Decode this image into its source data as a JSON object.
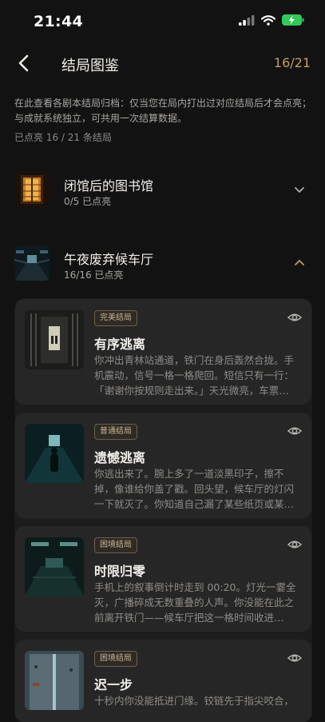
{
  "status_bar": {
    "time": "21:44"
  },
  "header": {
    "title": "结局图鉴",
    "count": "16/21"
  },
  "intro": {
    "description": "在此查看各剧本结局归档：仅当您在局内打出过对应结局后才会点亮；与成就系统独立，可共用一次结算数据。",
    "lit_count": "已点亮 16 / 21 条结局"
  },
  "scripts": [
    {
      "name": "闭馆后的图书馆",
      "progress": "0/5 已点亮",
      "expanded": false
    },
    {
      "name": "午夜废弃候车厅",
      "progress": "16/16 已点亮",
      "expanded": true
    }
  ],
  "endings": [
    {
      "badge": "完美结局",
      "title": "有序逃离",
      "text": "你冲出青林站通道，铁门在身后轰然合拢。手机震动，信号一格一格爬回。短信只有一行：「谢谢你按规则走出来。」天光微亮，车票…"
    },
    {
      "badge": "普通结局",
      "title": "遗憾逃离",
      "text": "你逃出来了。腕上多了一道淡黑印子，擦不掉，像谁给你盖了戳。回头望，候车厅的灯闪一下就灭了。你知道自己漏了某些纸页或某…"
    },
    {
      "badge": "困境结局",
      "title": "时限归零",
      "text": "手机上的叙事倒计时走到 00:20。灯光一霎全灭，广播碎成无数重叠的人声。你没能在此之前离开铁门——候车厅把这一格时间收进…"
    },
    {
      "badge": "困境结局",
      "title": "迟一步",
      "text": "十秒内你没能抵进门缘。铰链先于指尖咬合，"
    }
  ],
  "colors": {
    "accent": "#c49a62",
    "background": "#121212",
    "card": "#262626"
  },
  "icons": {
    "back": "chevron-left-icon",
    "collapse": "chevron-down-icon",
    "expand": "chevron-up-icon",
    "view": "eye-icon"
  }
}
